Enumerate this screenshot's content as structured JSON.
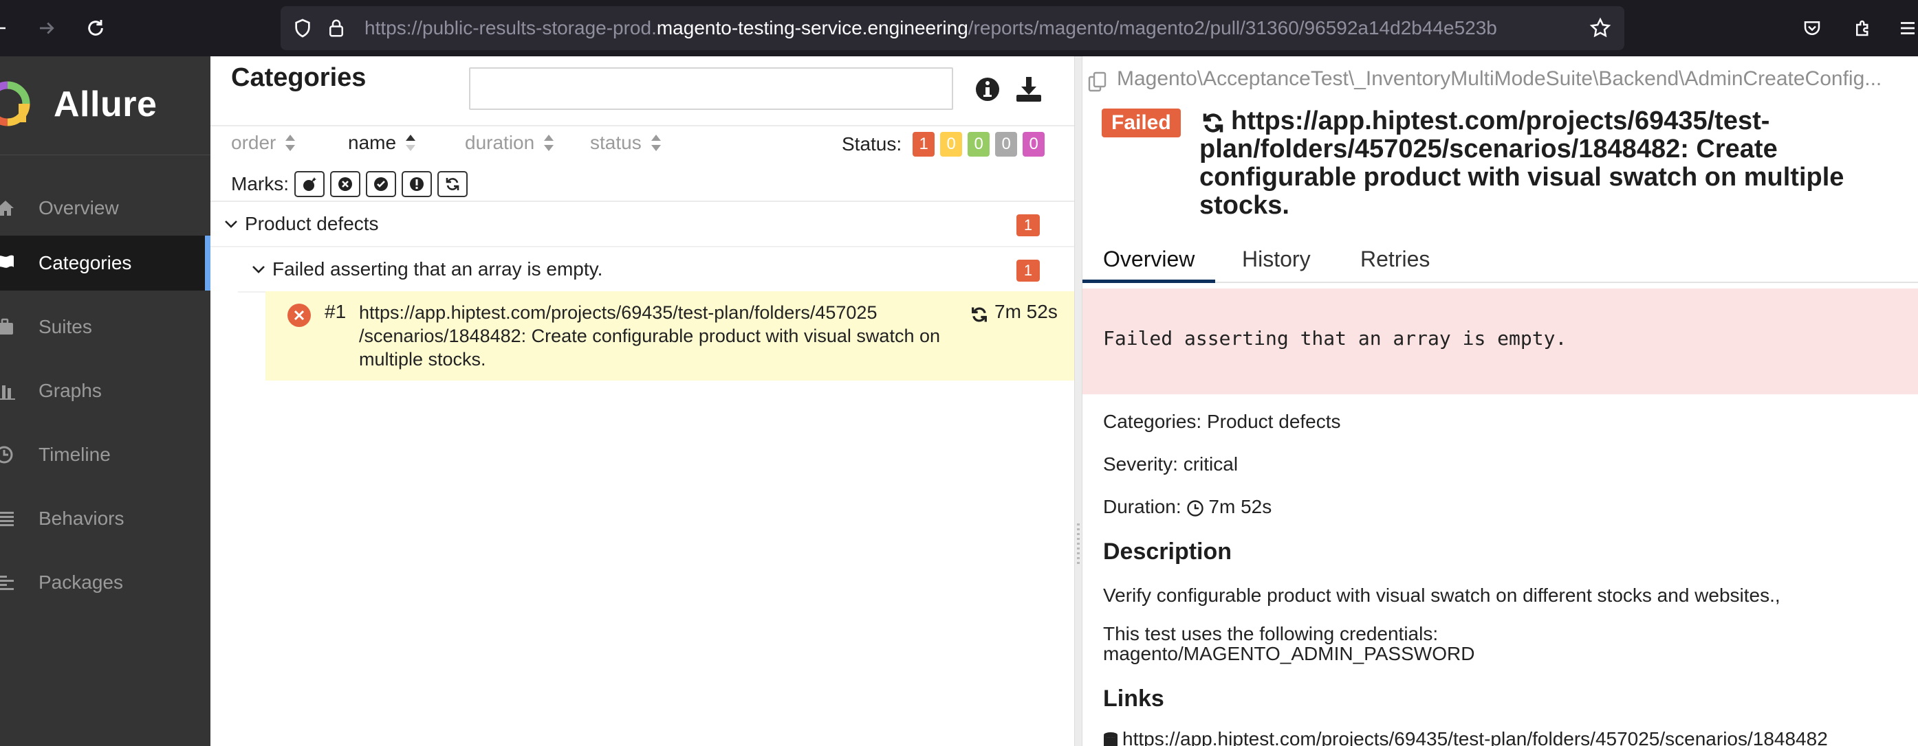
{
  "browser": {
    "url_prefix": "https://public-results-storage-prod.",
    "url_host": "magento-testing-service.engineering",
    "url_path": "/reports/magento/magento2/pull/31360/96592a14d2b44e523b"
  },
  "sidebar": {
    "brand": "Allure",
    "items": [
      {
        "label": "Overview",
        "icon": "home-icon"
      },
      {
        "label": "Categories",
        "icon": "flag-icon"
      },
      {
        "label": "Suites",
        "icon": "briefcase-icon"
      },
      {
        "label": "Graphs",
        "icon": "bar-chart-icon"
      },
      {
        "label": "Timeline",
        "icon": "clock-icon"
      },
      {
        "label": "Behaviors",
        "icon": "list-icon"
      },
      {
        "label": "Packages",
        "icon": "align-left-icon"
      }
    ],
    "active_index": 1
  },
  "categories_pane": {
    "title": "Categories",
    "search_value": "",
    "sort": [
      {
        "label": "order"
      },
      {
        "label": "name"
      },
      {
        "label": "duration"
      },
      {
        "label": "status"
      }
    ],
    "status_label": "Status:",
    "status_counts": [
      {
        "name": "failed",
        "value": "1",
        "color": "#e5623f"
      },
      {
        "name": "broken",
        "value": "0",
        "color": "#ffd050"
      },
      {
        "name": "passed",
        "value": "0",
        "color": "#97cc64"
      },
      {
        "name": "skipped",
        "value": "0",
        "color": "#aaaaaa"
      },
      {
        "name": "unknown",
        "value": "0",
        "color": "#d35ebe"
      }
    ],
    "marks_label": "Marks:",
    "marks": [
      "bomb-icon",
      "x-circle-icon",
      "check-circle-icon",
      "exclamation-icon",
      "refresh-icon"
    ],
    "tree": {
      "group": {
        "label": "Product defects",
        "count": "1"
      },
      "subgroup": {
        "label": "Failed asserting that an array is empty.",
        "count": "1"
      },
      "test": {
        "number": "#1",
        "name": "https://app.hiptest.com/projects/69435/test-plan/folders/457025 /scenarios/1848482: Create configurable product with visual swatch on multiple stocks.",
        "duration": "7m 52s"
      }
    }
  },
  "detail_pane": {
    "path": "Magento\\AcceptanceTest\\_InventoryMultiModeSuite\\Backend\\AdminCreateConfig...",
    "status": "Failed",
    "title": "https://app.hiptest.com/projects/69435/test-plan/folders/457025/scenarios/1848482: Create configurable product with visual swatch on multiple stocks.",
    "tabs": [
      "Overview",
      "History",
      "Retries"
    ],
    "error_message": "Failed asserting that an array is empty.",
    "categories_line": "Categories: Product defects",
    "severity_line": "Severity: critical",
    "duration_label": "Duration:",
    "duration_value": "7m 52s",
    "description_heading": "Description",
    "description_1": "Verify configurable product with visual swatch on different stocks and websites.,",
    "description_2a": "This test uses the following credentials:",
    "description_2b": "magento/MAGENTO_ADMIN_PASSWORD",
    "links_heading": "Links",
    "link_1": "https://app.hiptest.com/projects/69435/test-plan/folders/457025/scenarios/1848482"
  }
}
